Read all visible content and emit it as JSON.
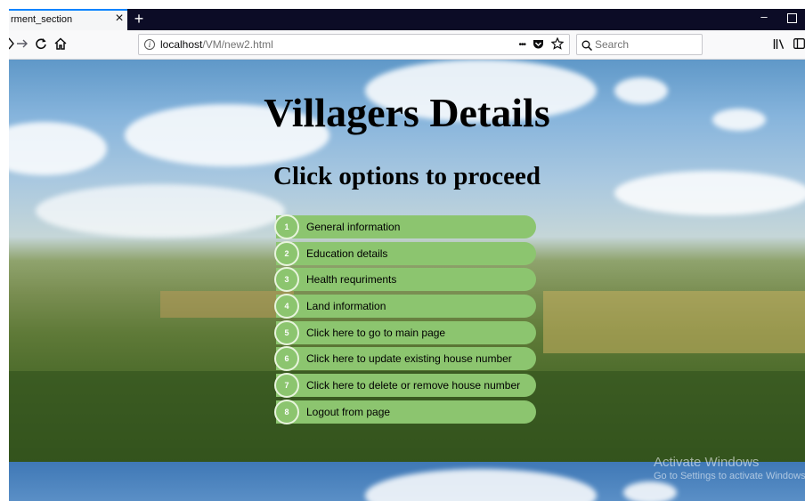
{
  "browser": {
    "tab_title": "rment_section",
    "tab_close": "×",
    "new_tab": "+",
    "min_label": "–",
    "url_host": "localhost",
    "url_path": "/VM/new2.html",
    "url_more": "•••",
    "search_placeholder": "Search"
  },
  "page": {
    "title": "Villagers Details",
    "subtitle": "Click options to proceed",
    "menu": [
      {
        "num": "1",
        "label": "General information"
      },
      {
        "num": "2",
        "label": "Education details"
      },
      {
        "num": "3",
        "label": "Health requriments"
      },
      {
        "num": "4",
        "label": "Land information"
      },
      {
        "num": "5",
        "label": "Click here to go to main page"
      },
      {
        "num": "6",
        "label": "Click here to update existing house number"
      },
      {
        "num": "7",
        "label": "Click here to delete or remove house number"
      },
      {
        "num": "8",
        "label": "Logout from page"
      }
    ]
  },
  "watermark": {
    "line1": "Activate Windows",
    "line2": "Go to Settings to activate Windows."
  },
  "colors": {
    "menu_green": "#8cc56f",
    "titlebar": "#0c0c26",
    "accent": "#0a84ff"
  }
}
